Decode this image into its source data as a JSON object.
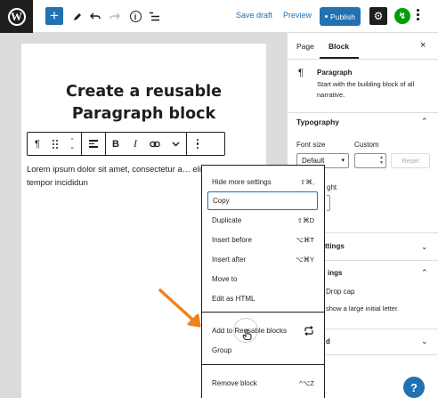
{
  "topbar": {
    "logo_letter": "W",
    "add_icon": "+",
    "save_draft": "Save draft",
    "preview": "Preview",
    "publish": "Publish",
    "info_letter": "i"
  },
  "editor": {
    "title": "Create a reusable Paragraph block",
    "paragraph": "Lorem ipsum dolor sit amet, consectetur a… elit, sed do eiusmod tempor incididun"
  },
  "block_toolbar": {
    "bold": "B",
    "italic": "I"
  },
  "menu": {
    "items": [
      {
        "label": "Hide more settings",
        "shortcut": "⇧⌘,"
      },
      {
        "label": "Copy",
        "shortcut": ""
      },
      {
        "label": "Duplicate",
        "shortcut": "⇧⌘D"
      },
      {
        "label": "Insert before",
        "shortcut": "⌥⌘T"
      },
      {
        "label": "Insert after",
        "shortcut": "⌥⌘Y"
      },
      {
        "label": "Move to",
        "shortcut": ""
      },
      {
        "label": "Edit as HTML",
        "shortcut": ""
      },
      {
        "label": "Add to Reusable blocks",
        "shortcut": ""
      },
      {
        "label": "Group",
        "shortcut": ""
      },
      {
        "label": "Remove block",
        "shortcut": "^⌥Z"
      }
    ]
  },
  "sidebar": {
    "tab_page": "Page",
    "tab_block": "Block",
    "block_name": "Paragraph",
    "block_desc": "Start with the building block of all narrative.",
    "typography": "Typography",
    "font_size_label": "Font size",
    "custom_label": "Custom",
    "font_size_value": "Default",
    "reset": "Reset",
    "partial_weight": "ght",
    "partial_settings1": "ttings",
    "partial_settings2": "ings",
    "drop_cap": "Drop cap",
    "drop_cap_desc": "show a large initial letter.",
    "partial_d": "d",
    "help": "?"
  },
  "colors": {
    "accent": "#2271b1",
    "arrow": "#f0821e",
    "jetpack": "#069e08"
  }
}
